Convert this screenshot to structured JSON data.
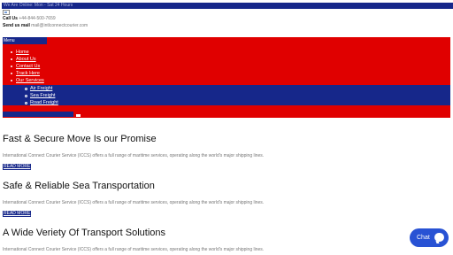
{
  "topbar": {
    "text": "We Are Online: Mon - Sat 24 Hours"
  },
  "contact": {
    "call_label": "Call Us",
    "call_value": "+44-844-500-7659",
    "mail_label": "Send us mail",
    "mail_value": "mail@intlconnectcourier.com"
  },
  "nav": {
    "menu_label": "Menu",
    "items": [
      {
        "label": "Home"
      },
      {
        "label": "About Us"
      },
      {
        "label": "Contact Us"
      },
      {
        "label": "Track Here"
      },
      {
        "label": "Our Services"
      }
    ],
    "sub_items": [
      {
        "label": "Air Freight"
      },
      {
        "label": "Sea Freight"
      },
      {
        "label": "Road Freight"
      }
    ]
  },
  "sections": [
    {
      "title": "Fast & Secure Move Is our Promise",
      "text": "International Connect Courier Service (ICCS) offers a full range of maritime services, operating along the world's major shipping lines.",
      "button": "READ MORE"
    },
    {
      "title": "Safe & Reliable Sea Transportation",
      "text": "International Connect Courier Service (ICCS) offers a full range of maritime services, operating along the world's major shipping lines.",
      "button": "READ MORE"
    },
    {
      "title": "A Wide Veriety Of Transport Solutions",
      "text": "International Connect Courier Service (ICCS) offers a full range of maritime services, operating along the world's major shipping lines."
    }
  ],
  "chat": {
    "label": "Chat",
    "icon": "chat-bubble-icon"
  },
  "colors": {
    "brand_blue": "#16278a",
    "nav_red": "#e00000",
    "chat_blue": "#2852d4"
  }
}
